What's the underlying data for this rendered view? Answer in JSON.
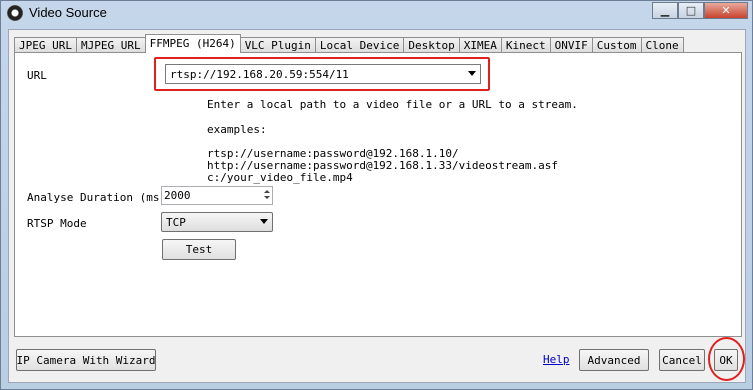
{
  "window": {
    "title": "Video Source",
    "app_icon": "webcam-icon",
    "controls": {
      "minimize": "▁",
      "maximize": "□",
      "close": "✕"
    }
  },
  "tabs": [
    {
      "label": "JPEG URL"
    },
    {
      "label": "MJPEG URL"
    },
    {
      "label": "FFMPEG (H264)",
      "active": true
    },
    {
      "label": "VLC Plugin"
    },
    {
      "label": "Local Device"
    },
    {
      "label": "Desktop"
    },
    {
      "label": "XIMEA"
    },
    {
      "label": "Kinect"
    },
    {
      "label": "ONVIF"
    },
    {
      "label": "Custom"
    },
    {
      "label": "Clone"
    }
  ],
  "form": {
    "url_label": "URL",
    "url_value": "rtsp://192.168.20.59:554/11",
    "info_line1": "Enter a local path to a video file or a URL to a stream.",
    "examples_label": "examples:",
    "example1": "rtsp://username:password@192.168.1.10/",
    "example2": "http://username:password@192.168.1.33/videostream.asf",
    "example3": "c:/your_video_file.mp4",
    "analyse_label": "Analyse Duration (ms)",
    "analyse_value": "2000",
    "rtsp_label": "RTSP Mode",
    "rtsp_value": "TCP",
    "test_button": "Test"
  },
  "footer": {
    "wizard_button": "IP Camera With Wizard",
    "help_link": "Help",
    "advanced_button": "Advanced",
    "cancel_button": "Cancel",
    "ok_button": "OK"
  },
  "annotation_color": "#e02020"
}
